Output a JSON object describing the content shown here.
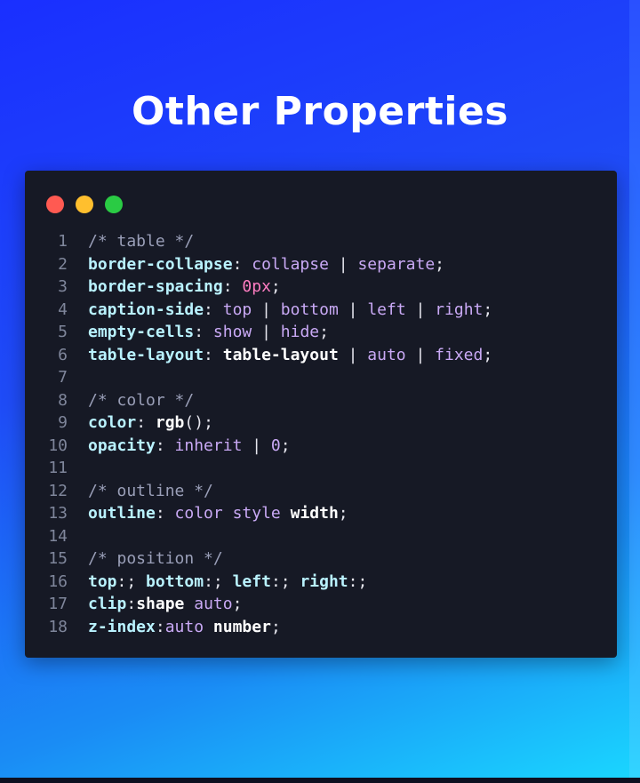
{
  "title": "Other Properties",
  "colors": {
    "red_dot": "#ff5a52",
    "yellow_dot": "#ffbf2e",
    "green_dot": "#2acb44",
    "window_bg": "#161925"
  },
  "code_lines": [
    {
      "n": "1",
      "tokens": [
        {
          "t": "/* table */",
          "k": "cmt"
        }
      ]
    },
    {
      "n": "2",
      "tokens": [
        {
          "t": "border-collapse",
          "k": "prop"
        },
        {
          "t": ": ",
          "k": "punc"
        },
        {
          "t": "collapse",
          "k": "val"
        },
        {
          "t": " | ",
          "k": "punc"
        },
        {
          "t": "separate",
          "k": "val"
        },
        {
          "t": ";",
          "k": "punc"
        }
      ]
    },
    {
      "n": "3",
      "tokens": [
        {
          "t": "border-spacing",
          "k": "prop"
        },
        {
          "t": ": ",
          "k": "punc"
        },
        {
          "t": "0px",
          "k": "num"
        },
        {
          "t": ";",
          "k": "punc"
        }
      ]
    },
    {
      "n": "4",
      "tokens": [
        {
          "t": "caption-side",
          "k": "prop"
        },
        {
          "t": ": ",
          "k": "punc"
        },
        {
          "t": "top",
          "k": "val"
        },
        {
          "t": " | ",
          "k": "punc"
        },
        {
          "t": "bottom",
          "k": "val"
        },
        {
          "t": " | ",
          "k": "punc"
        },
        {
          "t": "left",
          "k": "val"
        },
        {
          "t": " | ",
          "k": "punc"
        },
        {
          "t": "right",
          "k": "val"
        },
        {
          "t": ";",
          "k": "punc"
        }
      ]
    },
    {
      "n": "5",
      "tokens": [
        {
          "t": "empty-cells",
          "k": "prop"
        },
        {
          "t": ": ",
          "k": "punc"
        },
        {
          "t": "show",
          "k": "val"
        },
        {
          "t": " | ",
          "k": "punc"
        },
        {
          "t": "hide",
          "k": "val"
        },
        {
          "t": ";",
          "k": "punc"
        }
      ]
    },
    {
      "n": "6",
      "tokens": [
        {
          "t": "table-layout",
          "k": "prop"
        },
        {
          "t": ": ",
          "k": "punc"
        },
        {
          "t": "table-layout",
          "k": "plain"
        },
        {
          "t": " | ",
          "k": "punc"
        },
        {
          "t": "auto",
          "k": "val"
        },
        {
          "t": " | ",
          "k": "punc"
        },
        {
          "t": "fixed",
          "k": "val"
        },
        {
          "t": ";",
          "k": "punc"
        }
      ]
    },
    {
      "n": "7",
      "tokens": []
    },
    {
      "n": "8",
      "tokens": [
        {
          "t": "/* color */",
          "k": "cmt"
        }
      ]
    },
    {
      "n": "9",
      "tokens": [
        {
          "t": "color",
          "k": "prop"
        },
        {
          "t": ": ",
          "k": "punc"
        },
        {
          "t": "rgb",
          "k": "plain"
        },
        {
          "t": "();",
          "k": "punc"
        }
      ]
    },
    {
      "n": "10",
      "tokens": [
        {
          "t": "opacity",
          "k": "prop"
        },
        {
          "t": ": ",
          "k": "punc"
        },
        {
          "t": "inherit",
          "k": "val"
        },
        {
          "t": " | ",
          "k": "punc"
        },
        {
          "t": "0",
          "k": "val"
        },
        {
          "t": ";",
          "k": "punc"
        }
      ]
    },
    {
      "n": "11",
      "tokens": []
    },
    {
      "n": "12",
      "tokens": [
        {
          "t": "/* outline */",
          "k": "cmt"
        }
      ]
    },
    {
      "n": "13",
      "tokens": [
        {
          "t": "outline",
          "k": "prop"
        },
        {
          "t": ": ",
          "k": "punc"
        },
        {
          "t": "color",
          "k": "val"
        },
        {
          "t": " ",
          "k": "punc"
        },
        {
          "t": "style",
          "k": "val"
        },
        {
          "t": " ",
          "k": "punc"
        },
        {
          "t": "width",
          "k": "plain"
        },
        {
          "t": ";",
          "k": "punc"
        }
      ]
    },
    {
      "n": "14",
      "tokens": []
    },
    {
      "n": "15",
      "tokens": [
        {
          "t": "/* position */",
          "k": "cmt"
        }
      ]
    },
    {
      "n": "16",
      "tokens": [
        {
          "t": "top",
          "k": "prop"
        },
        {
          "t": ":; ",
          "k": "punc"
        },
        {
          "t": "bottom",
          "k": "prop"
        },
        {
          "t": ":; ",
          "k": "punc"
        },
        {
          "t": "left",
          "k": "prop"
        },
        {
          "t": ":; ",
          "k": "punc"
        },
        {
          "t": "right",
          "k": "prop"
        },
        {
          "t": ":;",
          "k": "punc"
        }
      ]
    },
    {
      "n": "17",
      "tokens": [
        {
          "t": "clip",
          "k": "prop"
        },
        {
          "t": ":",
          "k": "punc"
        },
        {
          "t": "shape",
          "k": "plain"
        },
        {
          "t": " ",
          "k": "punc"
        },
        {
          "t": "auto",
          "k": "val"
        },
        {
          "t": ";",
          "k": "punc"
        }
      ]
    },
    {
      "n": "18",
      "tokens": [
        {
          "t": "z-index",
          "k": "prop"
        },
        {
          "t": ":",
          "k": "punc"
        },
        {
          "t": "auto",
          "k": "val"
        },
        {
          "t": " ",
          "k": "punc"
        },
        {
          "t": "number",
          "k": "plain"
        },
        {
          "t": ";",
          "k": "punc"
        }
      ]
    }
  ]
}
